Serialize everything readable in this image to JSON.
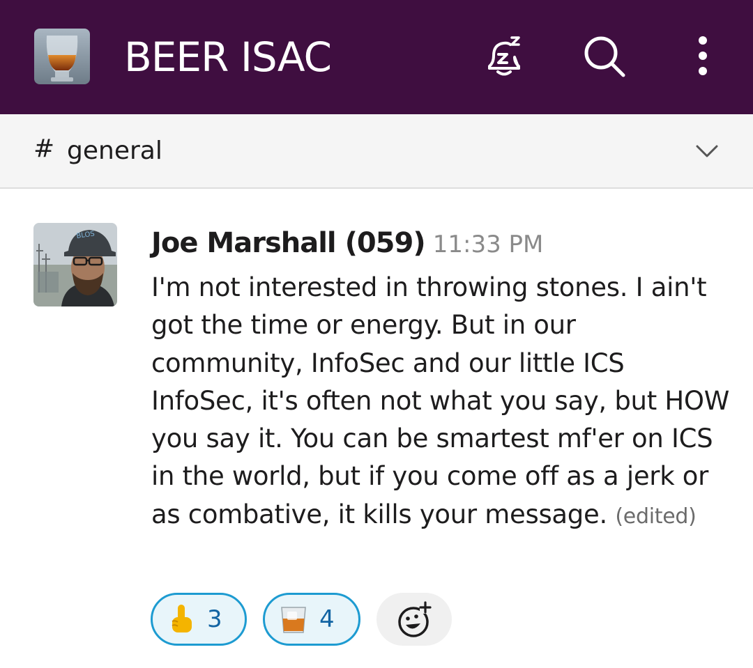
{
  "workspace": {
    "name": "BEER ISAC",
    "logo_icon": "beer-glass-logo"
  },
  "topbar": {
    "icons": [
      "snooze-bell-icon",
      "search-icon",
      "more-vertical-icon"
    ],
    "background": "#3f0e40"
  },
  "channel": {
    "prefix": "#",
    "name": "general"
  },
  "message": {
    "author": "Joe Marshall (059)",
    "time": "11:33 PM",
    "text": "I'm not interested in throwing stones. I ain't got the time or energy. But in our community, InfoSec and our little ICS InfoSec, it's often not what you say, but HOW you say it. You can be smartest mf'er on ICS in the world, but if you come off as a jerk or as combative, it kills your message.",
    "edited_label": "(edited)"
  },
  "reactions": [
    {
      "icon": "point-up-emoji",
      "count": "3"
    },
    {
      "icon": "tumbler-glass-emoji",
      "count": "4"
    }
  ],
  "add_reaction_icon": "add-reaction-icon",
  "colors": {
    "accent": "#1d9bd1",
    "reaction_bg": "#e8f5fa",
    "count_text": "#1264a3"
  }
}
